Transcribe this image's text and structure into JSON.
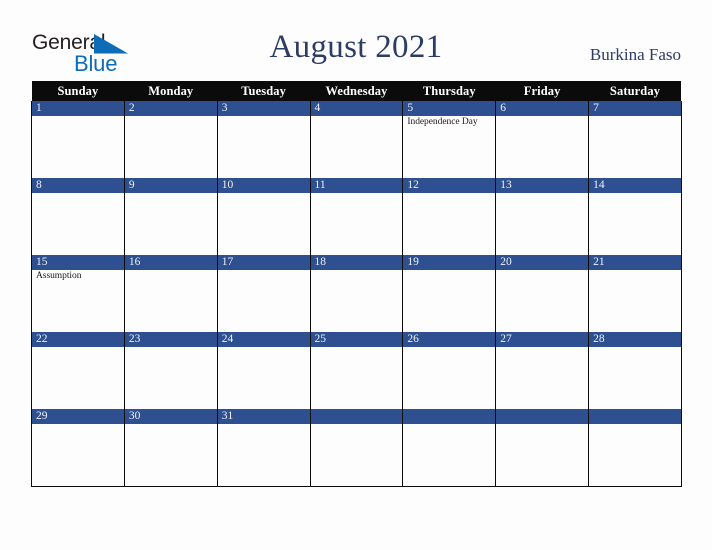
{
  "brand": {
    "line1": "General",
    "line2": "Blue",
    "pennant_icon": "blue-triangle-pennant-icon",
    "dark_color": "#231f20",
    "blue_color": "#0d6cb8"
  },
  "header": {
    "month_title": "August 2021",
    "country": "Burkina Faso",
    "title_color": "#2c3c64"
  },
  "theme": {
    "page_background": "#fdfdfd",
    "header_row_background": "#0b0b0b",
    "header_row_text": "#ffffff",
    "date_banner_background": "#2e5090",
    "date_banner_text": "#eef1f7",
    "grid_line": "#0b0b0b",
    "cell_background": "#fdfdfd",
    "holiday_text": "#1c1c1c"
  },
  "weekdays": [
    "Sunday",
    "Monday",
    "Tuesday",
    "Wednesday",
    "Thursday",
    "Friday",
    "Saturday"
  ],
  "weeks": [
    [
      {
        "date": "1",
        "holiday": ""
      },
      {
        "date": "2",
        "holiday": ""
      },
      {
        "date": "3",
        "holiday": ""
      },
      {
        "date": "4",
        "holiday": ""
      },
      {
        "date": "5",
        "holiday": "Independence Day"
      },
      {
        "date": "6",
        "holiday": ""
      },
      {
        "date": "7",
        "holiday": ""
      }
    ],
    [
      {
        "date": "8",
        "holiday": ""
      },
      {
        "date": "9",
        "holiday": ""
      },
      {
        "date": "10",
        "holiday": ""
      },
      {
        "date": "11",
        "holiday": ""
      },
      {
        "date": "12",
        "holiday": ""
      },
      {
        "date": "13",
        "holiday": ""
      },
      {
        "date": "14",
        "holiday": ""
      }
    ],
    [
      {
        "date": "15",
        "holiday": "Assumption"
      },
      {
        "date": "16",
        "holiday": ""
      },
      {
        "date": "17",
        "holiday": ""
      },
      {
        "date": "18",
        "holiday": ""
      },
      {
        "date": "19",
        "holiday": ""
      },
      {
        "date": "20",
        "holiday": ""
      },
      {
        "date": "21",
        "holiday": ""
      }
    ],
    [
      {
        "date": "22",
        "holiday": ""
      },
      {
        "date": "23",
        "holiday": ""
      },
      {
        "date": "24",
        "holiday": ""
      },
      {
        "date": "25",
        "holiday": ""
      },
      {
        "date": "26",
        "holiday": ""
      },
      {
        "date": "27",
        "holiday": ""
      },
      {
        "date": "28",
        "holiday": ""
      }
    ],
    [
      {
        "date": "29",
        "holiday": ""
      },
      {
        "date": "30",
        "holiday": ""
      },
      {
        "date": "31",
        "holiday": ""
      },
      {
        "date": "",
        "holiday": ""
      },
      {
        "date": "",
        "holiday": ""
      },
      {
        "date": "",
        "holiday": ""
      },
      {
        "date": "",
        "holiday": ""
      }
    ]
  ]
}
